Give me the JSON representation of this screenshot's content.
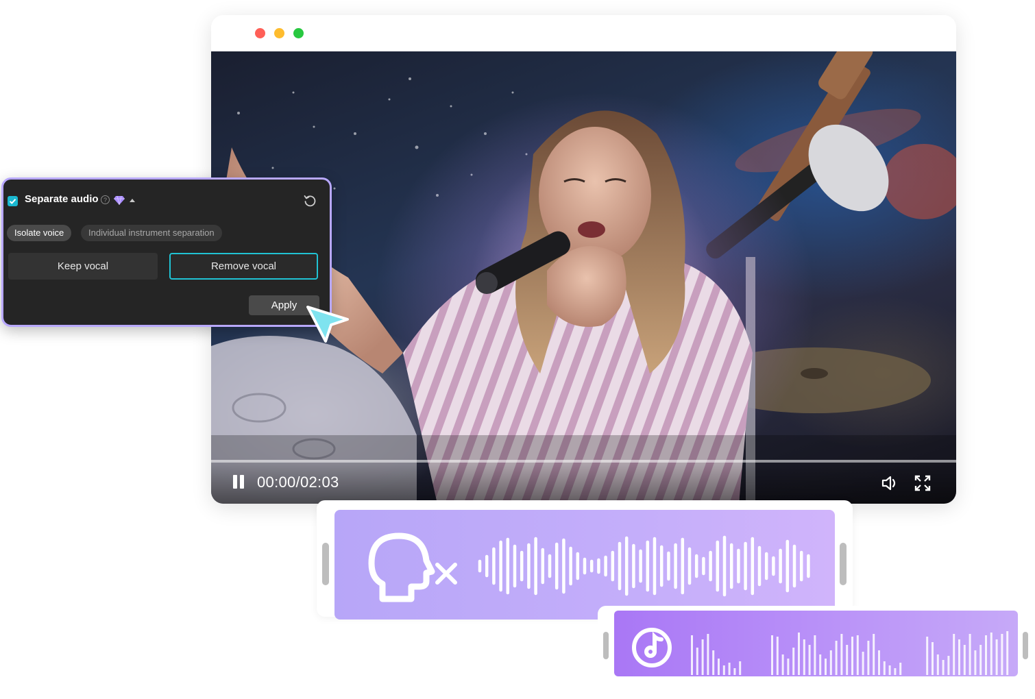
{
  "player": {
    "timecode": "00:00/02:03",
    "progress": 0.0,
    "icons": [
      "pause-icon",
      "volume-icon",
      "fullscreen-icon"
    ]
  },
  "panel": {
    "title": "Separate audio",
    "help_glyph": "?",
    "checked": true,
    "tabs": [
      {
        "label": "Isolate voice",
        "active": true
      },
      {
        "label": "Individual instrument separation",
        "active": false
      }
    ],
    "options": [
      {
        "label": "Keep vocal",
        "selected": false
      },
      {
        "label": "Remove vocal",
        "selected": true
      }
    ],
    "apply_label": "Apply",
    "icons": [
      "check-icon",
      "help-icon",
      "premium-gem-icon",
      "caret-up-icon",
      "reset-icon"
    ]
  },
  "tracks": {
    "voice_track": {
      "icon": "head-muted-icon"
    },
    "music_track": {
      "icon": "music-note-icon"
    }
  },
  "colors": {
    "panel_border": "#b8a8ff",
    "accent_cyan": "#20c3d4",
    "voice_track": "#b7a6f8",
    "music_track": "#a977f5",
    "cursor": "#7fe3ef"
  }
}
